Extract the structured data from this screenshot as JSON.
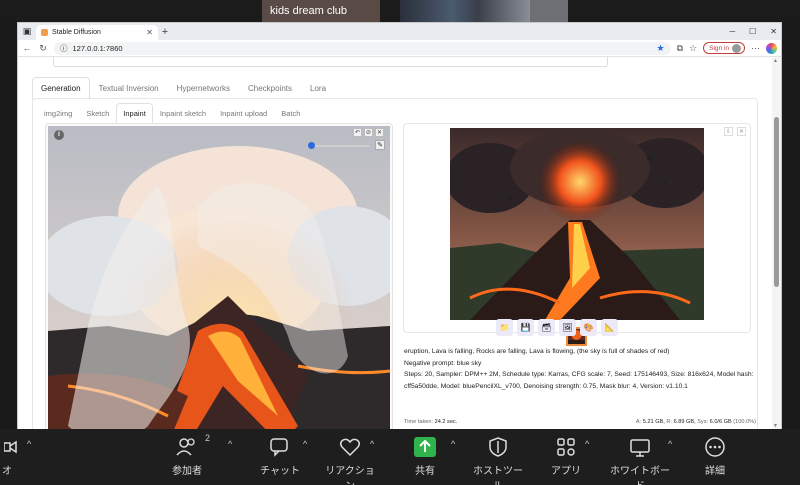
{
  "zoom_top": {
    "participant_name": "kids dream club"
  },
  "browser": {
    "tab_title": "Stable Diffusion",
    "url": "127.0.0.1:7860",
    "sign_in": "Sign in"
  },
  "main_tabs": [
    {
      "label": "Generation",
      "active": true
    },
    {
      "label": "Textual Inversion",
      "active": false
    },
    {
      "label": "Hypernetworks",
      "active": false
    },
    {
      "label": "Checkpoints",
      "active": false
    },
    {
      "label": "Lora",
      "active": false
    }
  ],
  "sub_tabs": [
    {
      "label": "img2img",
      "active": false
    },
    {
      "label": "Sketch",
      "active": false
    },
    {
      "label": "Inpaint",
      "active": true
    },
    {
      "label": "Inpaint sketch",
      "active": false
    },
    {
      "label": "Inpaint upload",
      "active": false
    },
    {
      "label": "Batch",
      "active": false
    }
  ],
  "info_icon": "i",
  "generation_info": {
    "line1": "eruption, Lava is falling, Rocks are falling, Lava is flowing, (the sky is full of shades of red)",
    "line2": "Negative prompt: blue sky",
    "line3": "Steps: 20, Sampler: DPM++ 2M, Schedule type: Karras, CFG scale: 7, Seed: 175146493, Size: 816x624, Model hash:",
    "line4": "cff5a50dde, Model: bluePencilXL_v700, Denoising strength: 0.75, Mask blur: 4, Version: v1.10.1"
  },
  "timing": {
    "time_label": "Time taken:",
    "time_value": "24.2 sec.",
    "vram_prefix": "A:",
    "vram_a": "5.21 GB,",
    "vram_r_label": "R:",
    "vram_r": "6.89 GB,",
    "vram_sys_label": "Sys:",
    "vram_sys": "6.0/6 GB",
    "vram_pct": "(100.0%)"
  },
  "zoom_toolbar": {
    "video_label": "オ",
    "participants_label": "参加者",
    "participants_count": "2",
    "chat_label": "チャット",
    "reactions_label": "リアクション",
    "share_label": "共有",
    "host_tools_label": "ホストツール",
    "apps_label": "アプリ",
    "whiteboard_label": "ホワイトボード",
    "more_label": "詳細"
  },
  "colors": {
    "accent": "#2a6ae0",
    "share_green": "#2fb34a",
    "signin_red": "#c63c3c",
    "thumb_border": "#f08a3a"
  }
}
